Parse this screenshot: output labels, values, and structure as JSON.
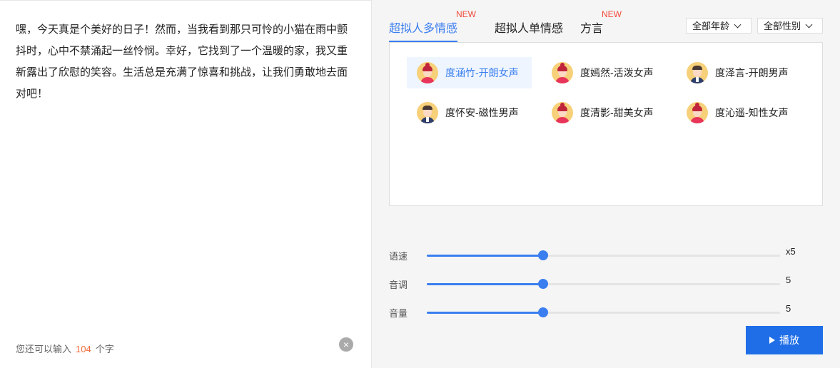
{
  "editor": {
    "text": "嘿，今天真是个美好的日子！然而，当我看到那只可怜的小猫在雨中颤抖时，心中不禁涌起一丝怜悯。幸好，它找到了一个温暖的家，我又重新露出了欣慰的笑容。生活总是充满了惊喜和挑战，让我们勇敢地去面对吧！",
    "counter_prefix": "您还可以输入",
    "remaining": "104",
    "counter_suffix": "个字",
    "clear_icon": "×"
  },
  "tabs": [
    {
      "label": "超拟人多情感",
      "badge": "NEW",
      "active": true
    },
    {
      "label": "超拟人单情感",
      "badge": "",
      "active": false
    },
    {
      "label": "方言",
      "badge": "NEW",
      "active": false
    }
  ],
  "filters": {
    "age": "全部年龄",
    "gender": "全部性别"
  },
  "voices": [
    {
      "name": "度涵竹-开朗女声",
      "gender": "female",
      "selected": true
    },
    {
      "name": "度嫣然-活泼女声",
      "gender": "female",
      "selected": false
    },
    {
      "name": "度泽言-开朗男声",
      "gender": "male",
      "selected": false
    },
    {
      "name": "度怀安-磁性男声",
      "gender": "male",
      "selected": false
    },
    {
      "name": "度清影-甜美女声",
      "gender": "female",
      "selected": false
    },
    {
      "name": "度沁遥-知性女声",
      "gender": "female",
      "selected": false
    }
  ],
  "sliders": [
    {
      "label": "语速",
      "value_text": "x5",
      "level": 0.33
    },
    {
      "label": "音调",
      "value_text": "5",
      "level": 0.33
    },
    {
      "label": "音量",
      "value_text": "5",
      "level": 0.33
    }
  ],
  "play_button": {
    "label": "播放"
  },
  "colors": {
    "accent": "#3a7ef0",
    "badge": "#f04a3a",
    "counter": "#f26c3c"
  }
}
